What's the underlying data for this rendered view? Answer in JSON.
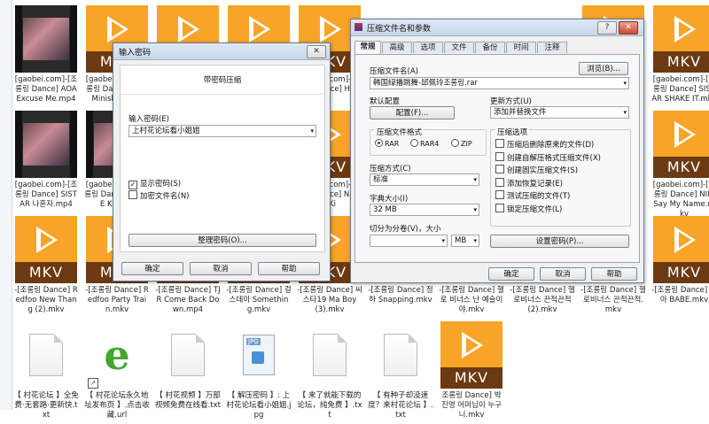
{
  "files": [
    {
      "col": 0,
      "row": 0,
      "type": "vid",
      "caption": "[gaobei.com]-[조롱링 Dance] AOA Excuse Me.mp4"
    },
    {
      "col": 1,
      "row": 0,
      "type": "mkv",
      "caption": "[gaobei.com]-[조롱링 Dance] AOA Miniskirt.mkv"
    },
    {
      "col": 2,
      "row": 0,
      "type": "mkv",
      "caption": ""
    },
    {
      "col": 3,
      "row": 0,
      "type": "mkv",
      "caption": ""
    },
    {
      "col": 4,
      "row": 0,
      "type": "mkv",
      "caption": "[gaobei.com]-[조롱링 Dance] HOT"
    },
    {
      "col": 8,
      "row": 0,
      "type": "mkv",
      "caption": ""
    },
    {
      "col": 9,
      "row": 0,
      "type": "mkv",
      "caption": "[gaobei.com]-[조롱링 Dance] SISTAR SHAKE IT.mkv"
    },
    {
      "col": 0,
      "row": 1,
      "type": "vid",
      "caption": "[gaobei.com]-[조롱링 Dance] SISTAR 나혼자.mp4"
    },
    {
      "col": 1,
      "row": 1,
      "type": "vid",
      "caption": "[gaobei.com]-[조롱링 Dance] TWICE KNOCK"
    },
    {
      "col": 4,
      "row": 1,
      "type": "mkv",
      "caption": "[gaobei.com]-[조롱링 Dance] Night Ki"
    },
    {
      "col": 9,
      "row": 1,
      "type": "mkv",
      "caption": "[gaobei.com]-[조롱링 Dance] NIKI Say My Name.mkv"
    },
    {
      "col": 0,
      "row": 2,
      "type": "mkv",
      "caption": "-[조롱링 Dance] Redfoo New Thang (2).mkv"
    },
    {
      "col": 1,
      "row": 2,
      "type": "mkv",
      "caption": "-[조롱링 Dance] Redfoo Party Train.mkv"
    },
    {
      "col": 2,
      "row": 2,
      "type": "mkv",
      "caption": "-[조롱링 Dance] TJR Come Back Down.mp4"
    },
    {
      "col": 3,
      "row": 2,
      "type": "mkv",
      "caption": "-[조롱링 Dance] 걸스데이 Something.mkv"
    },
    {
      "col": 4,
      "row": 2,
      "type": "mkv",
      "caption": "-[조롱링 Dance] 씨스타19 Ma Boy (3).mkv"
    },
    {
      "col": 5,
      "row": 2,
      "type": "mkv",
      "caption": "-[조롱링 Dance] 정하 Snapping.mkv"
    },
    {
      "col": 6,
      "row": 2,
      "type": "mkv",
      "caption": "-[조롱링 Dance] 헬로 비너스 난 예슬이야.mkv"
    },
    {
      "col": 7,
      "row": 2,
      "type": "mkv",
      "caption": "-[조롱링 Dance] 헬로비너스 끈적끈적 (2).mkv"
    },
    {
      "col": 8,
      "row": 2,
      "type": "mkv",
      "caption": "-[조롱링 Dance] 헬로비너스 끈적끈적.mkv"
    },
    {
      "col": 9,
      "row": 2,
      "type": "mkv",
      "caption": "-[조롱링 Dance] 현아 BABE.mkv"
    },
    {
      "col": 0,
      "row": 3,
      "type": "doc",
      "caption": "【 村花论坛 】全免费·无套路·更新快.txt"
    },
    {
      "col": 1,
      "row": 3,
      "type": "ie",
      "caption": "【 村花论坛永久地址发布页 】.点击收藏.url"
    },
    {
      "col": 2,
      "row": 3,
      "type": "doc",
      "caption": "【 村花视频 】万部视频免费在线看.txt"
    },
    {
      "col": 3,
      "row": 3,
      "type": "jpg",
      "caption": "【 解压密码 】: 上村花论坛看小姐姐.jpg"
    },
    {
      "col": 4,
      "row": 3,
      "type": "doc",
      "caption": "【 来了就能下载的论坛，纯免费 】.txt"
    },
    {
      "col": 5,
      "row": 3,
      "type": "doc",
      "caption": "【 有种子却没速度？来村花论坛 】.txt"
    },
    {
      "col": 6,
      "row": 3,
      "type": "mkv",
      "caption": "조롱링 Dance] 박진영 어머님이 누구니.mkv"
    }
  ],
  "password_dialog": {
    "title": "输入密码",
    "heading": "带密码压缩",
    "password_label": "输入密码(E)",
    "password_value": "上村花论坛看小姐姐",
    "show_password_label": "显示密码(S)",
    "show_password_checked": true,
    "encrypt_names_label": "加密文件名(N)",
    "encrypt_names_checked": false,
    "organize_button": "整理密码(O)...",
    "ok_button": "确定",
    "cancel_button": "取消",
    "help_button": "帮助"
  },
  "archive_dialog": {
    "title": "压缩文件名和参数",
    "tabs": [
      "常规",
      "高级",
      "选项",
      "文件",
      "备份",
      "时间",
      "注释"
    ],
    "active_tab": "常规",
    "archive_name_label": "压缩文件名(A)",
    "archive_name_value": "韩国绿播跳舞-邱佩玲조롱링.rar",
    "browse_button": "浏览(B)...",
    "default_config_label": "默认配置",
    "config_button": "配置(F)...",
    "update_mode_label": "更新方式(U)",
    "update_mode_value": "添加并替换文件",
    "format_label": "压缩文件格式",
    "formats": [
      {
        "label": "RAR",
        "checked": true
      },
      {
        "label": "RAR4",
        "checked": false
      },
      {
        "label": "ZIP",
        "checked": false
      }
    ],
    "method_label": "压缩方式(C)",
    "method_value": "标准",
    "dict_label": "字典大小(I)",
    "dict_value": "32 MB",
    "split_label": "切分为分卷(V)，大小",
    "split_unit": "MB",
    "options_label": "压缩选项",
    "options": [
      {
        "label": "压缩后删除原来的文件(D)",
        "checked": false
      },
      {
        "label": "创建自解压格式压缩文件(X)",
        "checked": false
      },
      {
        "label": "创建固实压缩文件(S)",
        "checked": false
      },
      {
        "label": "添加恢复记录(E)",
        "checked": false
      },
      {
        "label": "测试压缩的文件(T)",
        "checked": false
      },
      {
        "label": "锁定压缩文件(L)",
        "checked": false
      }
    ],
    "set_password_button": "设置密码(P)...",
    "ok_button": "确定",
    "cancel_button": "取消",
    "help_button": "帮助",
    "help_icon_label": "?",
    "close_icon_label": "✕"
  },
  "icons": {
    "mkv_label": "MKV",
    "jpg_label": "JPG",
    "ie_glyph": "e",
    "shortcut_glyph": "↗",
    "dropdown_glyph": "▾"
  },
  "colors": {
    "mkv_orange": "#f7a428",
    "mkv_band": "#6b3a12",
    "title_bar": "#c7d6ea"
  }
}
